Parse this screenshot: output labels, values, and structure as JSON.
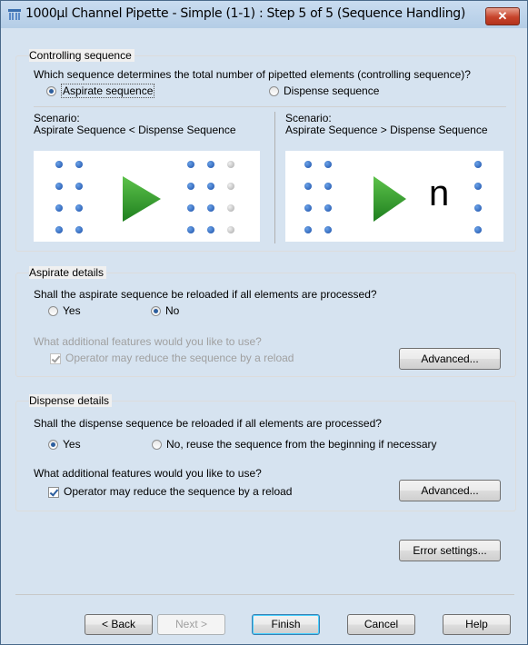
{
  "window": {
    "title": "1000µl Channel Pipette - Simple (1-1) : Step 5 of 5 (Sequence Handling)",
    "close_label": "✕"
  },
  "controlling": {
    "group_title": "Controlling sequence",
    "question": "Which sequence determines the total number of pipetted elements (controlling sequence)?",
    "option_aspirate": "Aspirate sequence",
    "option_dispense": "Dispense sequence",
    "selected": "aspirate",
    "scenario_left_label": "Scenario:",
    "scenario_left_desc": "Aspirate Sequence < Dispense Sequence",
    "scenario_right_label": "Scenario:",
    "scenario_right_desc": "Aspirate Sequence > Dispense Sequence",
    "scenario_right_symbol": "n"
  },
  "aspirate": {
    "group_title": "Aspirate details",
    "question": "Shall the aspirate sequence be reloaded if all elements are processed?",
    "option_yes": "Yes",
    "option_no": "No",
    "selected": "no",
    "features_label": "What additional features would you like to use?",
    "checkbox_label": "Operator may reduce the sequence by a reload",
    "checkbox_checked": true,
    "advanced_label": "Advanced..."
  },
  "dispense": {
    "group_title": "Dispense details",
    "question": "Shall the dispense sequence be reloaded if all elements are processed?",
    "option_yes": "Yes",
    "option_no": "No, reuse the sequence from the beginning if necessary",
    "selected": "yes",
    "features_label": "What additional features would you like to use?",
    "checkbox_label": "Operator may reduce the sequence by a reload",
    "checkbox_checked": true,
    "advanced_label": "Advanced..."
  },
  "error_settings_label": "Error settings...",
  "footer": {
    "back_label": "< Back",
    "next_label": "Next >",
    "finish_label": "Finish",
    "cancel_label": "Cancel",
    "help_label": "Help"
  },
  "colors": {
    "accent_blue": "#1b4fa8",
    "arrow_green": "#2e9a2e",
    "close_red": "#c7432b"
  }
}
